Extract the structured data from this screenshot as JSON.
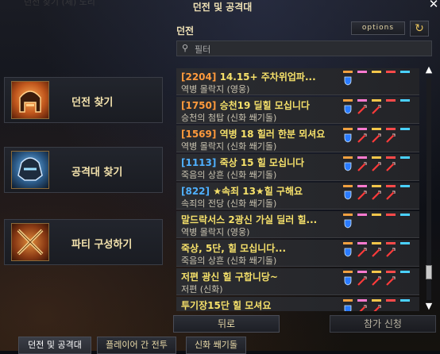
{
  "window": {
    "title": "던전 및 공격대",
    "ghost_title": "던전 찾기 (체) 노리"
  },
  "side_nav": [
    {
      "label": "던전 찾기",
      "icon": "helmet-orange-icon"
    },
    {
      "label": "공격대 찾기",
      "icon": "helmet-blue-icon"
    },
    {
      "label": "파티 구성하기",
      "icon": "crossed-swords-icon"
    }
  ],
  "section": {
    "label": "던전",
    "options_label": "options"
  },
  "filter": {
    "placeholder": "필터"
  },
  "listings": [
    {
      "num": "[2204]",
      "title": "14.15+ 주차위업파...",
      "sub": "역병 몰락지 (영웅)",
      "num_color": "orange"
    },
    {
      "num": "[1750]",
      "title": "승천19 딜힐 모십니다",
      "sub": "승천의 첨탑 (신화 쐐기돌)",
      "num_color": "orange"
    },
    {
      "num": "[1569]",
      "title": "역병 18 힐러 한분 뫼셔요",
      "sub": "역병 몰락지 (신화 쐐기돌)",
      "num_color": "orange"
    },
    {
      "num": "[1113]",
      "title": "죽상 15 힐 모십니다",
      "sub": "죽음의 상흔 (신화 쐐기돌)",
      "num_color": "blue"
    },
    {
      "num": "[822]",
      "title": "★속죄 13★힐 구해요",
      "sub": "속죄의 전당 (신화 쐐기돌)",
      "num_color": "blue"
    },
    {
      "num": "",
      "title": "말드락서스 2광신 가실 딜러 힐...",
      "sub": "역병 몰락지 (영웅)",
      "num_color": "orange"
    },
    {
      "num": "",
      "title": "죽상, 5단, 힐 모십니다...",
      "sub": "죽음의 상흔 (신화 쐐기돌)",
      "num_color": "orange"
    },
    {
      "num": "",
      "title": "저편 광신  힐 구합니당~",
      "sub": "저편 (신화)",
      "num_color": "orange"
    },
    {
      "num": "",
      "title": "투기장15단 힐 모셔요",
      "sub": "",
      "num_color": "orange"
    }
  ],
  "scroll": {
    "position": 0.9
  },
  "buttons": {
    "back": "뒤로",
    "join": "참가 신청"
  },
  "tabs": [
    "던전 및 공격대",
    "플레이어 간 전투",
    "신화 쐐기돌"
  ],
  "colors": {
    "number_orange": "#ff9a3c",
    "number_blue": "#4fb0ff",
    "title_yellow": "#f5e06a",
    "tank_blue": "#2a7bff",
    "dps_red": "#ff3a3a"
  }
}
